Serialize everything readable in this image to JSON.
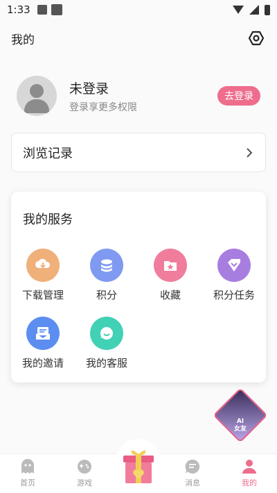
{
  "status": {
    "time": "1:33"
  },
  "header": {
    "title": "我的"
  },
  "profile": {
    "name": "未登录",
    "subtitle": "登录享更多权限",
    "login_label": "去登录"
  },
  "history": {
    "label": "浏览记录"
  },
  "services": {
    "title": "我的服务",
    "items": [
      {
        "label": "下载管理",
        "icon": "download-icon",
        "color": "#f0b07a"
      },
      {
        "label": "积分",
        "icon": "coins-icon",
        "color": "#7f9af0"
      },
      {
        "label": "收藏",
        "icon": "favorite-folder-icon",
        "color": "#f07d9c"
      },
      {
        "label": "积分任务",
        "icon": "tag-icon",
        "color": "#a87de0"
      },
      {
        "label": "我的邀请",
        "icon": "invite-mail-icon",
        "color": "#5b8ef0"
      },
      {
        "label": "我的客服",
        "icon": "chat-icon",
        "color": "#41d1b4"
      }
    ]
  },
  "ai_badge": {
    "label": "AI\n女友"
  },
  "nav": {
    "items": [
      {
        "label": "首页",
        "icon": "ghost-icon"
      },
      {
        "label": "游戏",
        "icon": "gamepad-icon"
      },
      {
        "label": "",
        "icon": "gift-icon"
      },
      {
        "label": "消息",
        "icon": "message-icon"
      },
      {
        "label": "我的",
        "icon": "person-icon"
      }
    ]
  },
  "colors": {
    "accent": "#ee6d8d"
  }
}
